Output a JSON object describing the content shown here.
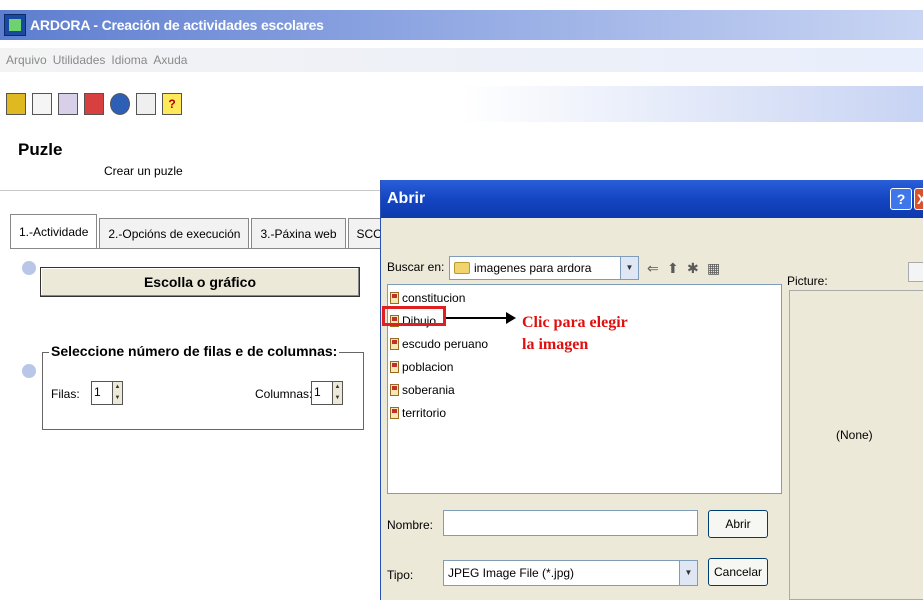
{
  "app": {
    "title": "ARDORA - Creación de actividades escolares"
  },
  "menu": [
    "Arquivo",
    "Utilidades",
    "Idioma",
    "Axuda"
  ],
  "toolbar": {
    "icons": [
      "exit-icon",
      "new-document-icon",
      "open-icon",
      "save-icon",
      "globe-icon",
      "style-icon",
      "help-icon"
    ],
    "help_glyph": "?"
  },
  "section": {
    "title": "Puzle",
    "subtitle": "Crear un puzle"
  },
  "tabs": [
    {
      "label": "1.-Actividade",
      "active": true
    },
    {
      "label": "2.-Opcións de execución",
      "active": false
    },
    {
      "label": "3.-Páxina web",
      "active": false
    },
    {
      "label": "SCORM",
      "active": false
    }
  ],
  "step1": {
    "button": "Escolla o gráfico"
  },
  "step2": {
    "legend": "Seleccione número de filas e de columnas:",
    "rows_label": "Filas:",
    "rows_value": "1",
    "cols_label": "Columnas:",
    "cols_value": "1"
  },
  "dialog": {
    "title": "Abrir",
    "help_btn": "?",
    "close_btn": "X",
    "lookin_label": "Buscar en:",
    "lookin_value": "imagenes para ardora",
    "files": [
      "constitucion",
      "Dibujo",
      "escudo peruano",
      "poblacion",
      "soberania",
      "territorio"
    ],
    "selected_file": "Dibujo",
    "preview_label": "Picture:",
    "preview_none": "(None)",
    "name_label": "Nombre:",
    "name_value": "",
    "type_label": "Tipo:",
    "type_value": "JPEG Image File (*.jpg)",
    "open_btn": "Abrir",
    "cancel_btn": "Cancelar"
  },
  "annotation": {
    "line1": "Clic para elegir",
    "line2": "la imagen",
    "color": "#e01010"
  }
}
